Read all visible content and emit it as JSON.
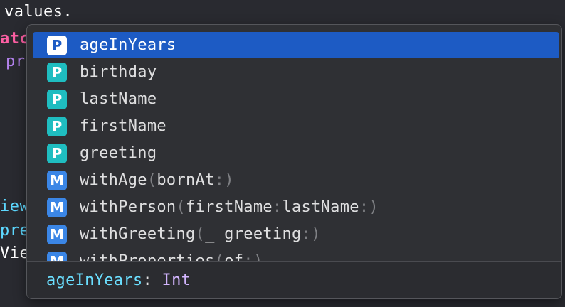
{
  "editor": {
    "line_values": "values.",
    "line_tc": "atc",
    "line_pr": "pr",
    "line_iew": "iew",
    "line_pre": "pre",
    "line_vie": "Vie"
  },
  "completion": {
    "items": [
      {
        "kind": "P",
        "name": "ageInYears",
        "params": "",
        "selected": true
      },
      {
        "kind": "P",
        "name": "birthday",
        "params": ""
      },
      {
        "kind": "P",
        "name": "lastName",
        "params": ""
      },
      {
        "kind": "P",
        "name": "firstName",
        "params": ""
      },
      {
        "kind": "P",
        "name": "greeting",
        "params": ""
      },
      {
        "kind": "M",
        "name": "withAge",
        "pre": "(",
        "params": "bornAt",
        "post": ":)"
      },
      {
        "kind": "M",
        "name": "withPerson",
        "pre": "(",
        "params": "firstName",
        "mid": ":",
        "params2": "lastName",
        "post": ":)"
      },
      {
        "kind": "M",
        "name": "withGreeting",
        "pre": "(",
        "params": "_ greeting",
        "post": ":)"
      },
      {
        "kind": "M",
        "name": "withProperties",
        "pre": "(",
        "params": "of",
        "post": ":)"
      }
    ],
    "footer": {
      "name": "ageInYears",
      "colon": ": ",
      "type": "Int"
    }
  },
  "colors": {
    "selection": "#1d5bc4",
    "property_badge": "#1fbdc0",
    "method_badge": "#3b86e6"
  }
}
